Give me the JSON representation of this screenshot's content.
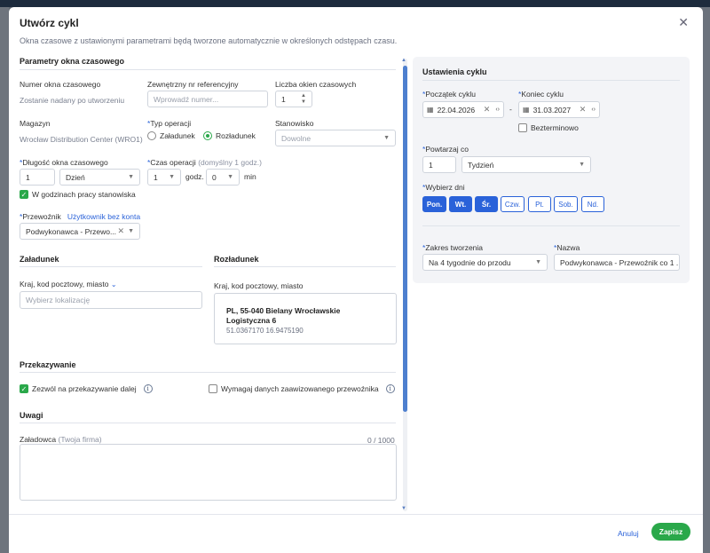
{
  "modal": {
    "title": "Utwórz cykl",
    "subtitle": "Okna czasowe z ustawionymi parametrami będą tworzone automatycznie w określonych odstępach czasu."
  },
  "params": {
    "header": "Parametry okna czasowego",
    "window_number_label": "Numer okna czasowego",
    "window_number_value": "Zostanie nadany po utworzeniu",
    "external_ref_label": "Zewnętrzny nr referencyjny",
    "external_ref_placeholder": "Wprowadź numer...",
    "window_count_label": "Liczba okien czasowych",
    "window_count_value": "1",
    "warehouse_label": "Magazyn",
    "warehouse_value": "Wrocław Distribution Center (WRO1)",
    "operation_type_label": "Typ operacji",
    "operation_loading": "Załadunek",
    "operation_unloading": "Rozładunek",
    "station_label": "Stanowisko",
    "station_value": "Dowolne",
    "window_length_label": "Długość okna czasowego",
    "window_length_value": "1",
    "window_length_unit": "Dzień",
    "operation_time_label": "Czas operacji",
    "operation_time_hint": "(domyślny 1 godz.)",
    "hours_value": "1",
    "hours_unit": "godz.",
    "minutes_value": "0",
    "minutes_unit": "min",
    "work_hours_label": "W godzinach pracy stanowiska",
    "carrier_label": "Przewoźnik",
    "carrier_link": "Użytkownik bez konta",
    "carrier_value": "Podwykonawca - Przewo..."
  },
  "loading": {
    "header": "Załadunek",
    "location_label": "Kraj, kod pocztowy, miasto",
    "location_placeholder": "Wybierz lokalizację"
  },
  "unloading": {
    "header": "Rozładunek",
    "location_label": "Kraj, kod pocztowy, miasto",
    "address_line1": "PL, 55-040 Bielany Wrocławskie",
    "address_line2": "Logistyczna 6",
    "coordinates": "51.0367170 16.9475190"
  },
  "forwarding": {
    "header": "Przekazywanie",
    "allow_forwarding": "Zezwól na przekazywanie dalej",
    "require_advanced": "Wymagaj danych zaawizowanego przewoźnika"
  },
  "notes": {
    "header": "Uwagi",
    "loader_label": "Załadowca",
    "loader_hint": "(Twoja firma)",
    "counter": "0 / 1000"
  },
  "cycle": {
    "header": "Ustawienia cyklu",
    "start_label": "Początek cyklu",
    "start_value": "22.04.2026",
    "end_label": "Koniec cyklu",
    "end_value": "31.03.2027",
    "dash": "-",
    "indefinite_label": "Bezterminowo",
    "repeat_label": "Powtarzaj co",
    "repeat_value": "1",
    "repeat_unit": "Tydzień",
    "days_label": "Wybierz dni",
    "days": [
      {
        "label": "Pon.",
        "selected": true
      },
      {
        "label": "Wt.",
        "selected": true
      },
      {
        "label": "Śr.",
        "selected": true
      },
      {
        "label": "Czw.",
        "selected": false
      },
      {
        "label": "Pt.",
        "selected": false
      },
      {
        "label": "Sob.",
        "selected": false
      },
      {
        "label": "Nd.",
        "selected": false
      }
    ],
    "range_label": "Zakres tworzenia",
    "range_value": "Na 4 tygodnie do przodu",
    "name_label": "Nazwa",
    "name_value": "Podwykonawca - Przewoźnik co 1 ..."
  },
  "footer": {
    "cancel": "Anuluj",
    "save": "Zapisz"
  },
  "colors": {
    "accent_blue": "#2a62d9",
    "accent_green": "#2aa84a"
  }
}
